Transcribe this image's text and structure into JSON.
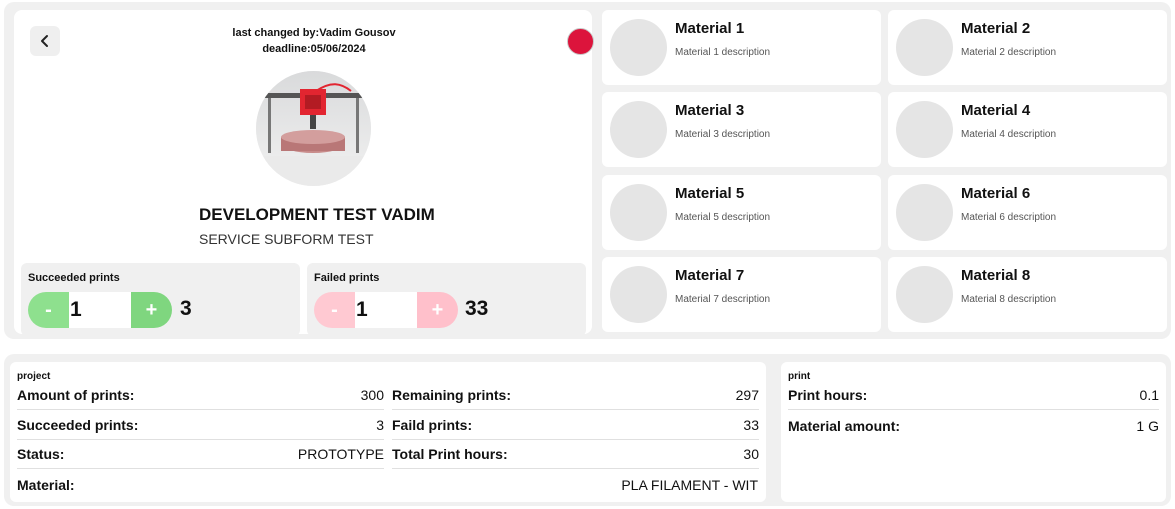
{
  "header": {
    "last_changed": "last changed by:Vadim Gousov",
    "deadline": "deadline:05/06/2024",
    "status_color": "#dc143c"
  },
  "project": {
    "title": "DEVELOPMENT TEST VADIM",
    "subtitle": "SERVICE SUBFORM TEST"
  },
  "counters": {
    "succeeded": {
      "label": "Succeeded prints",
      "minus": "-",
      "plus": "+",
      "value": "1",
      "total": "3"
    },
    "failed": {
      "label": "Failed prints",
      "minus": "-",
      "plus": "+",
      "value": "1",
      "total": "33"
    }
  },
  "materials": [
    {
      "name": "Material 1",
      "description": "Material 1 description"
    },
    {
      "name": "Material 2",
      "description": "Material 2 description"
    },
    {
      "name": "Material 3",
      "description": "Material 3 description"
    },
    {
      "name": "Material 4",
      "description": "Material 4 description"
    },
    {
      "name": "Material 5",
      "description": "Material 5 description"
    },
    {
      "name": "Material 6",
      "description": "Material 6 description"
    },
    {
      "name": "Material 7",
      "description": "Material 7 description"
    },
    {
      "name": "Material 8",
      "description": "Material 8 description"
    }
  ],
  "project_panel": {
    "label": "project",
    "left": [
      {
        "key": "Amount of prints:",
        "value": "300"
      },
      {
        "key": "Succeeded prints:",
        "value": "3"
      },
      {
        "key": "Status:",
        "value": "PROTOTYPE"
      },
      {
        "key": "Material:",
        "value": "PLA FILAMENT - WIT"
      }
    ],
    "right": [
      {
        "key": "Remaining prints:",
        "value": "297"
      },
      {
        "key": "Faild prints:",
        "value": "33"
      },
      {
        "key": "Total Print hours:",
        "value": "30"
      }
    ]
  },
  "print_panel": {
    "label": "print",
    "rows": [
      {
        "key": "Print hours:",
        "value": "0.1"
      },
      {
        "key": "Material amount:",
        "value": "1 G"
      }
    ]
  }
}
